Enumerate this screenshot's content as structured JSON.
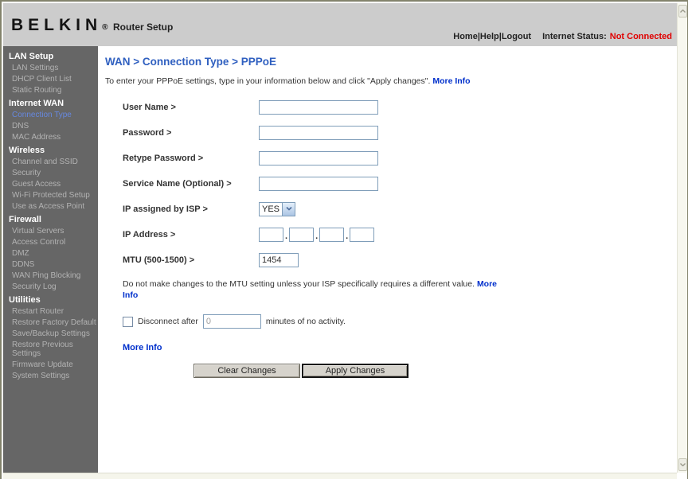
{
  "header": {
    "brand": "BELKIN",
    "brand_reg": "®",
    "app_title": "Router Setup",
    "nav": {
      "home": "Home",
      "help": "Help",
      "logout": "Logout",
      "separator": "|"
    },
    "status_label": "Internet Status:",
    "status_value": "Not Connected",
    "status_color": "#e00000"
  },
  "sidebar": {
    "sections": [
      {
        "label": "LAN Setup",
        "items": [
          {
            "label": "LAN Settings"
          },
          {
            "label": "DHCP Client List"
          },
          {
            "label": "Static Routing"
          }
        ]
      },
      {
        "label": "Internet WAN",
        "items": [
          {
            "label": "Connection Type",
            "active": true
          },
          {
            "label": "DNS"
          },
          {
            "label": "MAC Address"
          }
        ]
      },
      {
        "label": "Wireless",
        "items": [
          {
            "label": "Channel and SSID"
          },
          {
            "label": "Security"
          },
          {
            "label": "Guest Access"
          },
          {
            "label": "Wi-Fi Protected Setup"
          },
          {
            "label": "Use as Access Point"
          }
        ]
      },
      {
        "label": "Firewall",
        "items": [
          {
            "label": "Virtual Servers"
          },
          {
            "label": "Access Control"
          },
          {
            "label": "DMZ"
          },
          {
            "label": "DDNS"
          },
          {
            "label": "WAN Ping Blocking"
          },
          {
            "label": "Security Log"
          }
        ]
      },
      {
        "label": "Utilities",
        "items": [
          {
            "label": "Restart Router"
          },
          {
            "label": "Restore Factory Default"
          },
          {
            "label": "Save/Backup Settings"
          },
          {
            "label": "Restore Previous Settings"
          },
          {
            "label": "Firmware Update"
          },
          {
            "label": "System Settings"
          }
        ]
      }
    ],
    "active_color": "#6688e0",
    "bg_color": "#666666"
  },
  "main": {
    "breadcrumb": "WAN > Connection Type > PPPoE",
    "intro_text": "To enter your PPPoE settings, type in your information below and click \"Apply changes\". ",
    "more_info_label": "More Info",
    "fields": {
      "user_name_label": "User Name >",
      "password_label": "Password >",
      "retype_password_label": "Retype Password >",
      "service_name_label": "Service Name (Optional) >",
      "ip_assigned_label": "IP assigned by ISP >",
      "ip_assigned_value": "YES",
      "ip_address_label": "IP Address >",
      "ip_separator": ".",
      "mtu_label": "MTU (500-1500) >",
      "mtu_value": "1454"
    },
    "mtu_note": "Do not make changes to the MTU setting unless your ISP specifically requires a different value. ",
    "disconnect": {
      "label_before": "Disconnect after",
      "value": "0",
      "label_after": "minutes of no activity."
    },
    "buttons": {
      "clear": "Clear Changes",
      "apply": "Apply Changes"
    }
  }
}
